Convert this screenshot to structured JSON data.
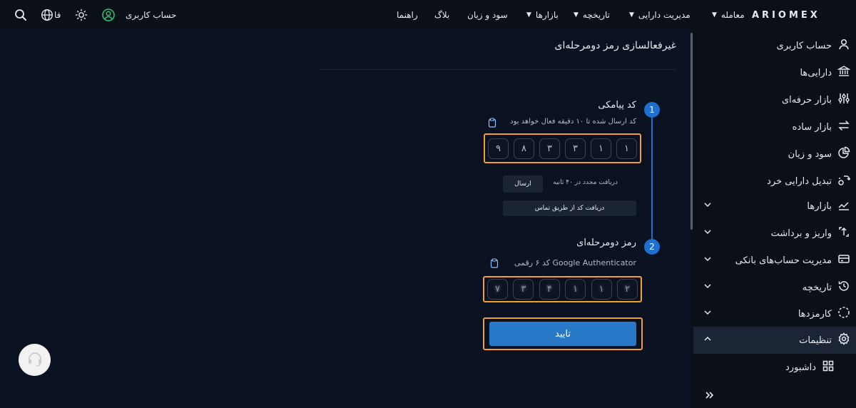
{
  "header": {
    "logo": "ARIOMEX",
    "nav": [
      {
        "label": "معامله",
        "has_caret": true
      },
      {
        "label": "مدیریت دارایی",
        "has_caret": true
      },
      {
        "label": "تاریخچه",
        "has_caret": true
      },
      {
        "label": "بازارها",
        "has_caret": true
      },
      {
        "label": "سود و زیان",
        "has_caret": false
      },
      {
        "label": "بلاگ",
        "has_caret": false
      },
      {
        "label": "راهنما",
        "has_caret": false
      }
    ],
    "account_label": "حساب کاربری",
    "language": "فا",
    "icons": [
      "user-circle-icon",
      "sun-icon",
      "globe-icon",
      "search-icon"
    ]
  },
  "sidebar": {
    "items": [
      {
        "label": "حساب کاربری",
        "icon": "user-icon",
        "expandable": false
      },
      {
        "label": "دارایی‌ها",
        "icon": "bank-icon",
        "expandable": false
      },
      {
        "label": "بازار حرفه‌ای",
        "icon": "sliders-icon",
        "expandable": false
      },
      {
        "label": "بازار ساده",
        "icon": "swap-icon",
        "expandable": false
      },
      {
        "label": "سود و زیان",
        "icon": "pie-chart-icon",
        "expandable": false
      },
      {
        "label": "تبدیل دارایی خرد",
        "icon": "convert-icon",
        "expandable": false
      },
      {
        "label": "بازارها",
        "icon": "chart-line-icon",
        "expandable": true
      },
      {
        "label": "واریز و برداشت",
        "icon": "deposit-icon",
        "expandable": true
      },
      {
        "label": "مدیریت حساب‌های بانکی",
        "icon": "card-icon",
        "expandable": true
      },
      {
        "label": "تاریخچه",
        "icon": "history-icon",
        "expandable": true
      },
      {
        "label": "کارمزدها",
        "icon": "fee-icon",
        "expandable": true
      },
      {
        "label": "تنظیمات",
        "icon": "settings-icon",
        "expandable": true,
        "active": true
      },
      {
        "label": "داشبورد",
        "icon": "dashboard-icon",
        "expandable": false,
        "sub": true
      }
    ],
    "collapse_icon": "double-chevron-icon"
  },
  "page": {
    "title": "غیرفعالسازی رمز دومرحله‌ای",
    "step1": {
      "number": "1",
      "title": "کد پیامکی",
      "subtitle": "کد ارسال شده تا ۱۰ دقیقه فعال خواهد بود",
      "digits": [
        "۱",
        "۱",
        "۳",
        "۳",
        "۸",
        "۹"
      ],
      "resend_text": "دریافت مجدد در ۴۰ ثانیه",
      "send_label": "ارسال",
      "call_label": "دریافت کد از طریق تماس"
    },
    "step2": {
      "number": "2",
      "title": "رمز دومرحله‌ای",
      "subtitle": "کد ۶ رقمی Google Authenticator",
      "digits": [
        "۲",
        "۱",
        "۱",
        "۴",
        "۳",
        "۷"
      ]
    },
    "confirm_label": "تایید"
  },
  "colors": {
    "background": "#0a1120",
    "accent_blue": "#1f6fd1",
    "highlight_orange": "#f0a12a",
    "confirm_button": "#2878c8"
  }
}
